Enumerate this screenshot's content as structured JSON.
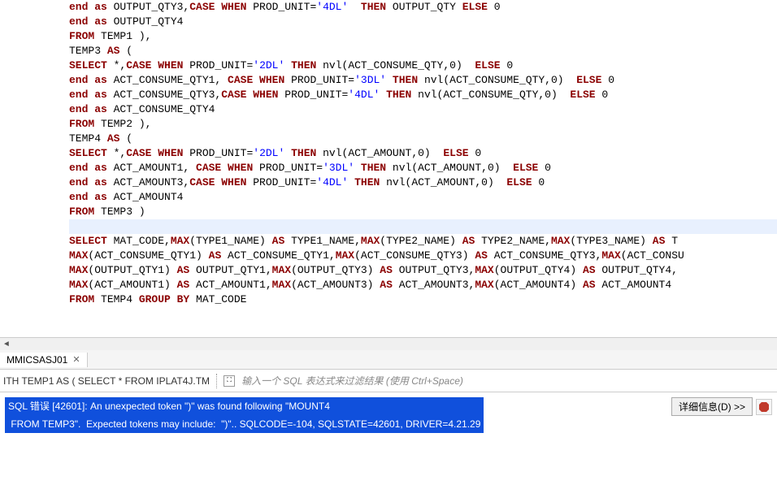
{
  "editor": {
    "lines": [
      {
        "segments": [
          {
            "cls": "kw",
            "t": "end as"
          },
          {
            "cls": "ident",
            "t": " OUTPUT_QTY3,"
          },
          {
            "cls": "kw",
            "t": "CASE WHEN"
          },
          {
            "cls": "ident",
            "t": " PROD_UNIT="
          },
          {
            "cls": "str",
            "t": "'4DL'"
          },
          {
            "cls": "ident",
            "t": "  "
          },
          {
            "cls": "kw",
            "t": "THEN"
          },
          {
            "cls": "ident",
            "t": " OUTPUT_QTY "
          },
          {
            "cls": "kw",
            "t": "ELSE"
          },
          {
            "cls": "ident",
            "t": " 0"
          }
        ]
      },
      {
        "segments": [
          {
            "cls": "kw",
            "t": "end as"
          },
          {
            "cls": "ident",
            "t": " OUTPUT_QTY4"
          }
        ]
      },
      {
        "segments": [
          {
            "cls": "kw",
            "t": "FROM"
          },
          {
            "cls": "ident",
            "t": " TEMP1 ),"
          }
        ]
      },
      {
        "segments": [
          {
            "cls": "ident",
            "t": "TEMP3 "
          },
          {
            "cls": "kw",
            "t": "AS"
          },
          {
            "cls": "ident",
            "t": " ("
          }
        ]
      },
      {
        "segments": [
          {
            "cls": "kw",
            "t": "SELECT"
          },
          {
            "cls": "ident",
            "t": " *,"
          },
          {
            "cls": "kw",
            "t": "CASE WHEN"
          },
          {
            "cls": "ident",
            "t": " PROD_UNIT="
          },
          {
            "cls": "str",
            "t": "'2DL'"
          },
          {
            "cls": "ident",
            "t": " "
          },
          {
            "cls": "kw",
            "t": "THEN"
          },
          {
            "cls": "ident",
            "t": " nvl(ACT_CONSUME_QTY,0)  "
          },
          {
            "cls": "kw",
            "t": "ELSE"
          },
          {
            "cls": "ident",
            "t": " 0"
          }
        ]
      },
      {
        "segments": [
          {
            "cls": "kw",
            "t": "end as"
          },
          {
            "cls": "ident",
            "t": " ACT_CONSUME_QTY1, "
          },
          {
            "cls": "kw",
            "t": "CASE WHEN"
          },
          {
            "cls": "ident",
            "t": " PROD_UNIT="
          },
          {
            "cls": "str",
            "t": "'3DL'"
          },
          {
            "cls": "ident",
            "t": " "
          },
          {
            "cls": "kw",
            "t": "THEN"
          },
          {
            "cls": "ident",
            "t": " nvl(ACT_CONSUME_QTY,0)  "
          },
          {
            "cls": "kw",
            "t": "ELSE"
          },
          {
            "cls": "ident",
            "t": " 0"
          }
        ]
      },
      {
        "segments": [
          {
            "cls": "kw",
            "t": "end as"
          },
          {
            "cls": "ident",
            "t": " ACT_CONSUME_QTY3,"
          },
          {
            "cls": "kw",
            "t": "CASE WHEN"
          },
          {
            "cls": "ident",
            "t": " PROD_UNIT="
          },
          {
            "cls": "str",
            "t": "'4DL'"
          },
          {
            "cls": "ident",
            "t": " "
          },
          {
            "cls": "kw",
            "t": "THEN"
          },
          {
            "cls": "ident",
            "t": " nvl(ACT_CONSUME_QTY,0)  "
          },
          {
            "cls": "kw",
            "t": "ELSE"
          },
          {
            "cls": "ident",
            "t": " 0"
          }
        ]
      },
      {
        "segments": [
          {
            "cls": "kw",
            "t": "end as"
          },
          {
            "cls": "ident",
            "t": " ACT_CONSUME_QTY4"
          }
        ]
      },
      {
        "segments": [
          {
            "cls": "kw",
            "t": "FROM"
          },
          {
            "cls": "ident",
            "t": " TEMP2 ),"
          }
        ]
      },
      {
        "segments": [
          {
            "cls": "ident",
            "t": "TEMP4 "
          },
          {
            "cls": "kw",
            "t": "AS"
          },
          {
            "cls": "ident",
            "t": " ("
          }
        ]
      },
      {
        "segments": [
          {
            "cls": "kw",
            "t": "SELECT"
          },
          {
            "cls": "ident",
            "t": " *,"
          },
          {
            "cls": "kw",
            "t": "CASE WHEN"
          },
          {
            "cls": "ident",
            "t": " PROD_UNIT="
          },
          {
            "cls": "str",
            "t": "'2DL'"
          },
          {
            "cls": "ident",
            "t": " "
          },
          {
            "cls": "kw",
            "t": "THEN"
          },
          {
            "cls": "ident",
            "t": " nvl(ACT_AMOUNT,0)  "
          },
          {
            "cls": "kw",
            "t": "ELSE"
          },
          {
            "cls": "ident",
            "t": " 0"
          }
        ]
      },
      {
        "segments": [
          {
            "cls": "kw",
            "t": "end as"
          },
          {
            "cls": "ident",
            "t": " ACT_AMOUNT1, "
          },
          {
            "cls": "kw",
            "t": "CASE WHEN"
          },
          {
            "cls": "ident",
            "t": " PROD_UNIT="
          },
          {
            "cls": "str",
            "t": "'3DL'"
          },
          {
            "cls": "ident",
            "t": " "
          },
          {
            "cls": "kw",
            "t": "THEN"
          },
          {
            "cls": "ident",
            "t": " nvl(ACT_AMOUNT,0)  "
          },
          {
            "cls": "kw",
            "t": "ELSE"
          },
          {
            "cls": "ident",
            "t": " 0"
          }
        ]
      },
      {
        "segments": [
          {
            "cls": "kw",
            "t": "end as"
          },
          {
            "cls": "ident",
            "t": " ACT_AMOUNT3,"
          },
          {
            "cls": "kw",
            "t": "CASE WHEN"
          },
          {
            "cls": "ident",
            "t": " PROD_UNIT="
          },
          {
            "cls": "str",
            "t": "'4DL'"
          },
          {
            "cls": "ident",
            "t": " "
          },
          {
            "cls": "kw",
            "t": "THEN"
          },
          {
            "cls": "ident",
            "t": " nvl(ACT_AMOUNT,0)  "
          },
          {
            "cls": "kw",
            "t": "ELSE"
          },
          {
            "cls": "ident",
            "t": " 0"
          }
        ]
      },
      {
        "segments": [
          {
            "cls": "kw",
            "t": "end as"
          },
          {
            "cls": "ident",
            "t": " ACT_AMOUNT4"
          }
        ]
      },
      {
        "segments": [
          {
            "cls": "kw",
            "t": "FROM"
          },
          {
            "cls": "ident",
            "t": " TEMP3 )"
          }
        ]
      },
      {
        "segments": [
          {
            "cls": "ident",
            "t": ""
          }
        ],
        "highlighted": true
      },
      {
        "segments": [
          {
            "cls": "kw",
            "t": "SELECT"
          },
          {
            "cls": "ident",
            "t": " MAT_CODE,"
          },
          {
            "cls": "kw",
            "t": "MAX"
          },
          {
            "cls": "ident",
            "t": "(TYPE1_NAME) "
          },
          {
            "cls": "kw",
            "t": "AS"
          },
          {
            "cls": "ident",
            "t": " TYPE1_NAME,"
          },
          {
            "cls": "kw",
            "t": "MAX"
          },
          {
            "cls": "ident",
            "t": "(TYPE2_NAME) "
          },
          {
            "cls": "kw",
            "t": "AS"
          },
          {
            "cls": "ident",
            "t": " TYPE2_NAME,"
          },
          {
            "cls": "kw",
            "t": "MAX"
          },
          {
            "cls": "ident",
            "t": "(TYPE3_NAME) "
          },
          {
            "cls": "kw",
            "t": "AS"
          },
          {
            "cls": "ident",
            "t": " T"
          }
        ]
      },
      {
        "segments": [
          {
            "cls": "kw",
            "t": "MAX"
          },
          {
            "cls": "ident",
            "t": "(ACT_CONSUME_QTY1) "
          },
          {
            "cls": "kw",
            "t": "AS"
          },
          {
            "cls": "ident",
            "t": " ACT_CONSUME_QTY1,"
          },
          {
            "cls": "kw",
            "t": "MAX"
          },
          {
            "cls": "ident",
            "t": "(ACT_CONSUME_QTY3) "
          },
          {
            "cls": "kw",
            "t": "AS"
          },
          {
            "cls": "ident",
            "t": " ACT_CONSUME_QTY3,"
          },
          {
            "cls": "kw",
            "t": "MAX"
          },
          {
            "cls": "ident",
            "t": "(ACT_CONSU"
          }
        ]
      },
      {
        "segments": [
          {
            "cls": "kw",
            "t": "MAX"
          },
          {
            "cls": "ident",
            "t": "(OUTPUT_QTY1) "
          },
          {
            "cls": "kw",
            "t": "AS"
          },
          {
            "cls": "ident",
            "t": " OUTPUT_QTY1,"
          },
          {
            "cls": "kw",
            "t": "MAX"
          },
          {
            "cls": "ident",
            "t": "(OUTPUT_QTY3) "
          },
          {
            "cls": "kw",
            "t": "AS"
          },
          {
            "cls": "ident",
            "t": " OUTPUT_QTY3,"
          },
          {
            "cls": "kw",
            "t": "MAX"
          },
          {
            "cls": "ident",
            "t": "(OUTPUT_QTY4) "
          },
          {
            "cls": "kw",
            "t": "AS"
          },
          {
            "cls": "ident",
            "t": " OUTPUT_QTY4,"
          }
        ]
      },
      {
        "segments": [
          {
            "cls": "kw",
            "t": "MAX"
          },
          {
            "cls": "ident",
            "t": "(ACT_AMOUNT1) "
          },
          {
            "cls": "kw",
            "t": "AS"
          },
          {
            "cls": "ident",
            "t": " ACT_AMOUNT1,"
          },
          {
            "cls": "kw",
            "t": "MAX"
          },
          {
            "cls": "ident",
            "t": "(ACT_AMOUNT3) "
          },
          {
            "cls": "kw",
            "t": "AS"
          },
          {
            "cls": "ident",
            "t": " ACT_AMOUNT3,"
          },
          {
            "cls": "kw",
            "t": "MAX"
          },
          {
            "cls": "ident",
            "t": "(ACT_AMOUNT4) "
          },
          {
            "cls": "kw",
            "t": "AS"
          },
          {
            "cls": "ident",
            "t": " ACT_AMOUNT4"
          }
        ]
      },
      {
        "segments": [
          {
            "cls": "kw",
            "t": "FROM"
          },
          {
            "cls": "ident",
            "t": " TEMP4 "
          },
          {
            "cls": "kw",
            "t": "GROUP BY"
          },
          {
            "cls": "ident",
            "t": " MAT_CODE"
          }
        ]
      }
    ]
  },
  "tab": {
    "name": "MMICSASJ01"
  },
  "filter": {
    "query_text": "ITH TEMP1 AS ( SELECT * FROM IPLAT4J.TM",
    "placeholder": "输入一个 SQL 表达式来过滤结果 (使用 Ctrl+Space)"
  },
  "error": {
    "line1": "SQL 错误 [42601]: An unexpected token \")\" was found following \"MOUNT4",
    "line2": " FROM TEMP3\".  Expected tokens may include:  \")\".. SQLCODE=-104, SQLSTATE=42601, DRIVER=4.21.29",
    "details_button": "详细信息(D) >>"
  }
}
